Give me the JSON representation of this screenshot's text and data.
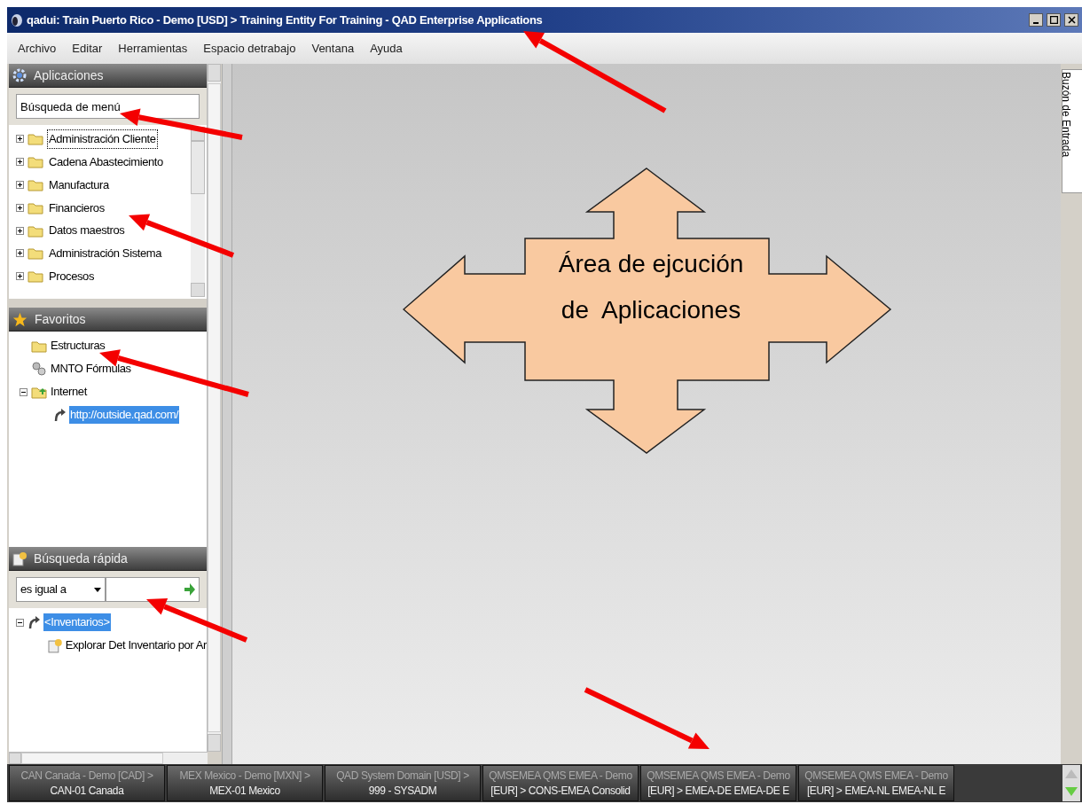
{
  "window": {
    "title": "qadui: Train Puerto Rico - Demo [USD] > Training Entity For Training - QAD Enterprise Applications"
  },
  "menu": [
    "Archivo",
    "Editar",
    "Herramientas",
    "Espacio detrabajo",
    "Ventana",
    "Ayuda"
  ],
  "applications": {
    "title": "Aplicaciones",
    "search": {
      "value": "Búsqueda de menú"
    },
    "items": [
      {
        "label": "Administración Cliente",
        "selected": true
      },
      {
        "label": "Cadena Abastecimiento",
        "selected": false
      },
      {
        "label": "Manufactura",
        "selected": false
      },
      {
        "label": "Financieros",
        "selected": false
      },
      {
        "label": "Datos maestros",
        "selected": false
      },
      {
        "label": "Administración Sistema",
        "selected": false
      },
      {
        "label": "Procesos",
        "selected": false
      }
    ]
  },
  "favorites": {
    "title": "Favoritos",
    "items": [
      {
        "label": "Estructuras",
        "kind": "folder"
      },
      {
        "label": "MNTO Fórmulas",
        "kind": "program"
      },
      {
        "label": "Internet",
        "kind": "web",
        "expanded": true,
        "children": [
          {
            "label": "http://outside.qad.com/",
            "kind": "link",
            "selected": true
          }
        ]
      }
    ]
  },
  "quick_search": {
    "title": "Búsqueda rápida",
    "operator": "es igual a",
    "results": [
      {
        "label": "<Inventarios>",
        "selected": true,
        "expanded": true,
        "children": [
          {
            "label": "Explorar Det Inventario por Ar",
            "selected": false
          }
        ]
      }
    ]
  },
  "inbox_tab": "Buzón de Entrada",
  "workspace": {
    "label_lines": [
      "Área de ejcución",
      "de  Aplicaciones"
    ]
  },
  "taskbar": [
    {
      "line1": "CAN Canada - Demo [CAD] >",
      "line2": "CAN-01 Canada"
    },
    {
      "line1": "MEX Mexico - Demo [MXN] >",
      "line2": "MEX-01 Mexico"
    },
    {
      "line1": "QAD System Domain [USD] >",
      "line2": "999 - SYSADM"
    },
    {
      "line1": "QMSEMEA QMS EMEA - Demo",
      "line2": "[EUR] > CONS-EMEA Consolid"
    },
    {
      "line1": "QMSEMEA QMS EMEA - Demo",
      "line2": "[EUR] > EMEA-DE EMEA-DE E"
    },
    {
      "line1": "QMSEMEA QMS EMEA - Demo",
      "line2": "[EUR] > EMEA-NL EMEA-NL E"
    }
  ]
}
